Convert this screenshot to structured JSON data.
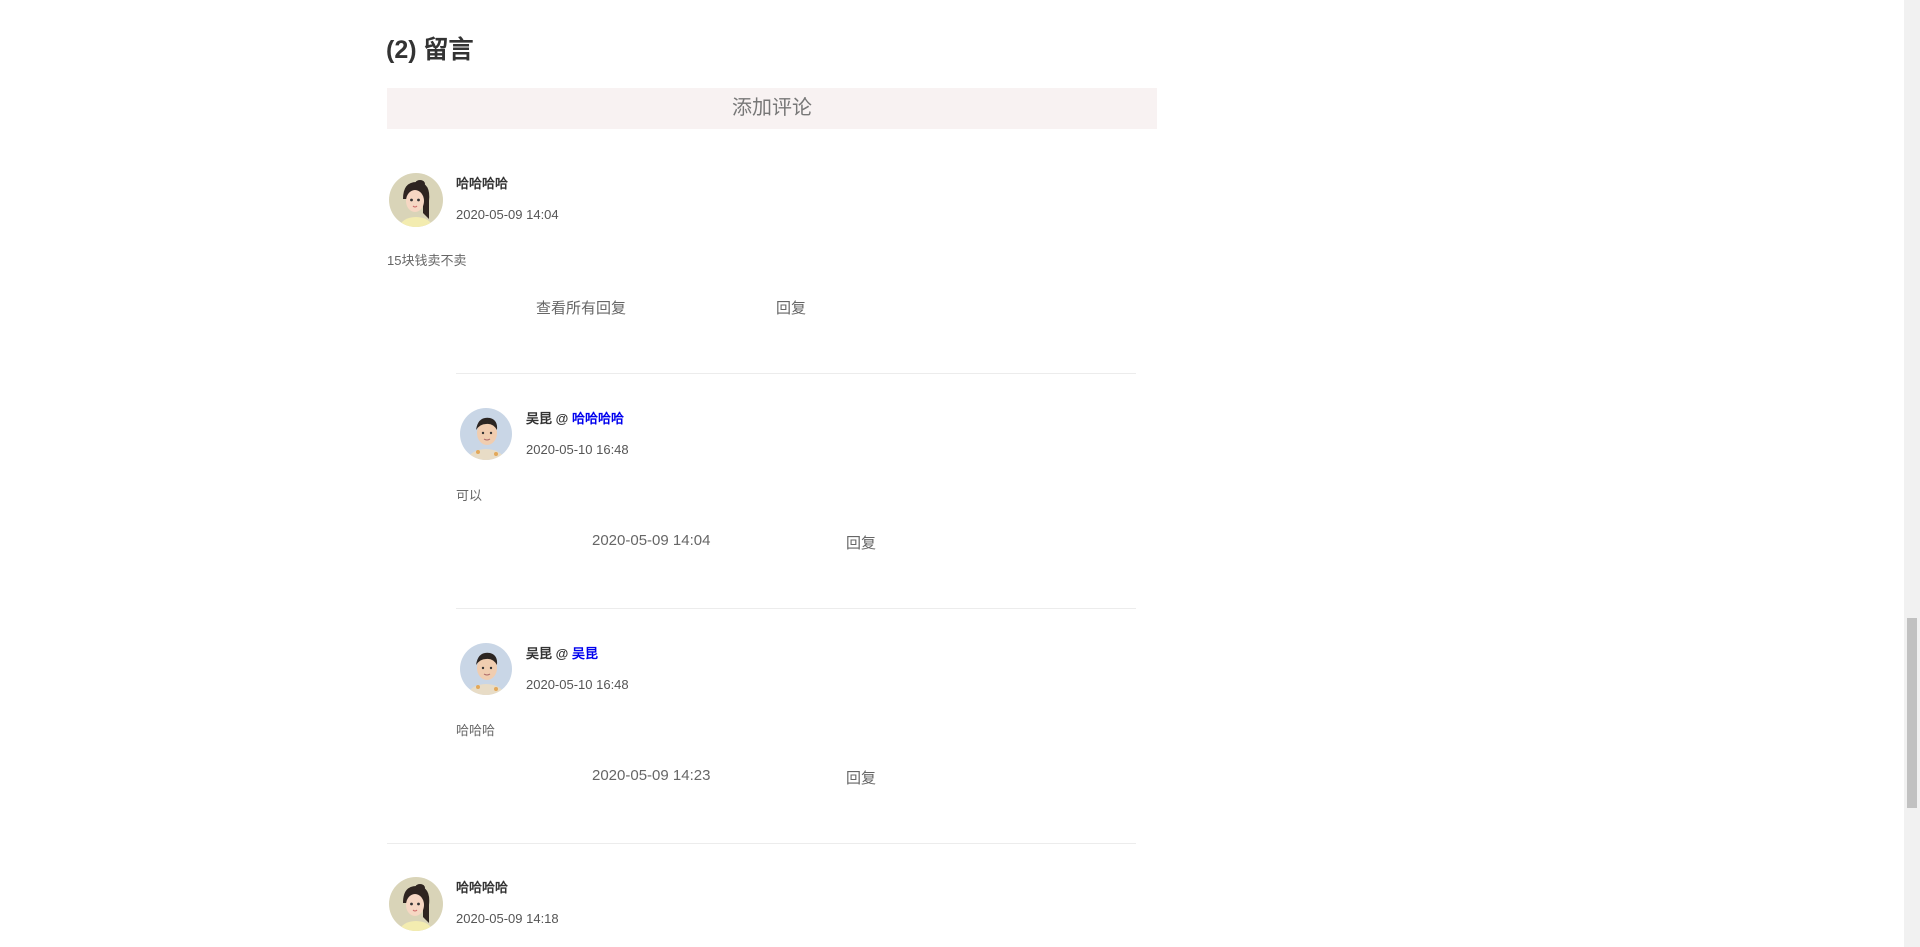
{
  "section": {
    "title": "(2) 留言",
    "add_comment_label": "添加评论"
  },
  "comments": [
    {
      "user": "哈哈哈哈",
      "time": "2020-05-09 14:04",
      "content": "15块钱卖不卖",
      "view_all_label": "查看所有回复",
      "reply_label": "回复"
    },
    {
      "user": "哈哈哈哈",
      "time": "2020-05-09 14:18"
    }
  ],
  "replies": [
    {
      "user": "吴昆",
      "at": "@",
      "target": "哈哈哈哈",
      "time": "2020-05-10 16:48",
      "content": "可以",
      "meta_time": "2020-05-09 14:04",
      "reply_label": "回复"
    },
    {
      "user": "吴昆",
      "at": "@",
      "target": "吴昆",
      "time": "2020-05-10 16:48",
      "content": "哈哈哈",
      "meta_time": "2020-05-09 14:23",
      "reply_label": "回复"
    }
  ],
  "icons": {
    "girl_avatar": "girl-avatar-icon",
    "boy_avatar": "boy-avatar-icon"
  },
  "colors": {
    "link_blue": "#0000ee",
    "add_comment_bg": "#f8f2f2",
    "divider": "#ececec"
  }
}
